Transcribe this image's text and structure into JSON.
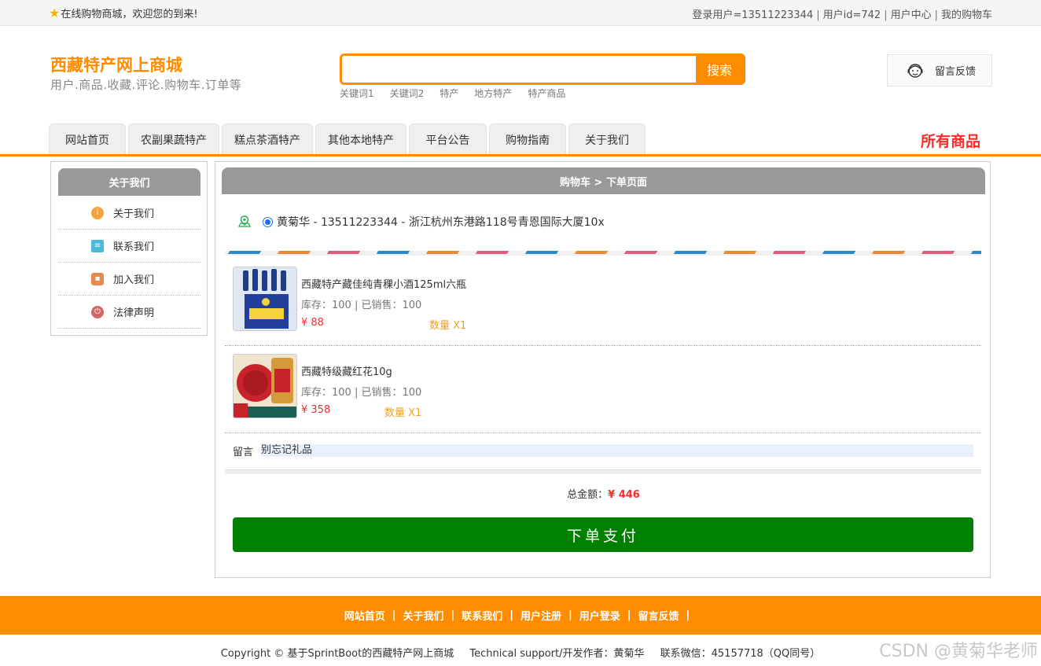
{
  "topbar": {
    "welcome": "在线购物商城，欢迎您的到来!",
    "login_user": "登录用户=13511223344",
    "user_id": "用户id=742",
    "user_center": "用户中心",
    "my_cart": "我的购物车"
  },
  "header": {
    "title": "西藏特产网上商城",
    "subtitle": "用户.商品.收藏.评论.购物车.订单等",
    "search_placeholder": "",
    "search_button": "搜索",
    "keywords": [
      "关键词1",
      "关键词2",
      "特产",
      "地方特产",
      "特产商品"
    ],
    "feedback": "留言反馈"
  },
  "nav": {
    "tabs": [
      "网站首页",
      "农副果蔬特产",
      "糕点茶酒特产",
      "其他本地特产",
      "平台公告",
      "购物指南",
      "关于我们"
    ],
    "all_goods": "所有商品"
  },
  "sidebar": {
    "title": "关于我们",
    "items": [
      {
        "label": "关于我们",
        "icon": "info-icon",
        "color": "#f7a23c"
      },
      {
        "label": "联系我们",
        "icon": "clipboard-icon",
        "color": "#4ab8d8"
      },
      {
        "label": "加入我们",
        "icon": "lock-icon",
        "color": "#e88a50"
      },
      {
        "label": "法律声明",
        "icon": "power-icon",
        "color": "#d06868"
      }
    ]
  },
  "main": {
    "breadcrumb": "购物车 > 下单页面",
    "address": "黄菊华 - 13511223344 - 浙江杭州东港路118号青恩国际大厦10x",
    "products": [
      {
        "name": "西藏特产藏佳纯青稞小酒125ml六瓶",
        "stock": "库存：100 | 已销售：100",
        "price": "¥ 88",
        "qty": "数量 X1"
      },
      {
        "name": "西藏特级藏红花10g",
        "stock": "库存：100 | 已销售：100",
        "price": "¥ 358",
        "qty": "数量 X1"
      }
    ],
    "message_label": "留言",
    "message_value": "别忘记礼品",
    "total_label": "总金额：",
    "total_value": "¥ 446",
    "pay_button": "下单支付"
  },
  "footer": {
    "links": [
      "网站首页",
      "关于我们",
      "联系我们",
      "用户注册",
      "用户登录",
      "留言反馈"
    ],
    "copyright": "Copyright © 基于SprintBoot的西藏特产网上商城",
    "support": "Technical support/开发作者：黄菊华",
    "contact": "联系微信：45157718（QQ同号）",
    "watermark": "CSDN @黄菊华老师"
  },
  "colors": {
    "accent": "#ff8c00",
    "price_red": "#ff2a2a",
    "pay_green": "#008000",
    "panel_gray": "#999999"
  }
}
